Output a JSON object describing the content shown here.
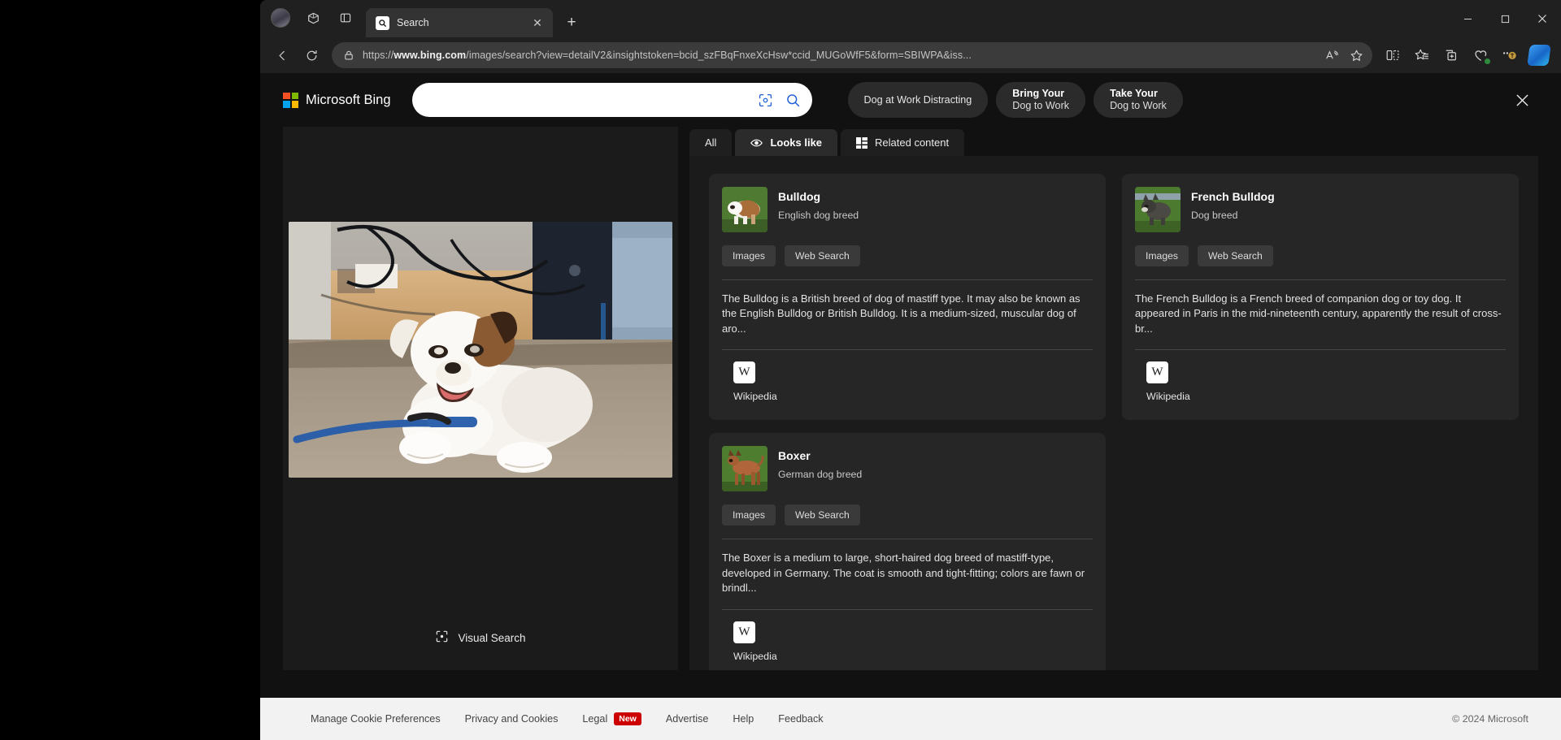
{
  "browser": {
    "tab": {
      "title": "Search",
      "favicon": "bing-search-icon",
      "close_label": "✕"
    },
    "new_tab_label": "+",
    "toolbar_left_icons": [
      "profile-avatar",
      "workspaces-icon",
      "tab-actions-icon"
    ],
    "window_controls": {
      "minimize": "–",
      "maximize": "▢",
      "close": "✕"
    },
    "nav": {
      "back": "←",
      "forward": "→",
      "refresh": "⟳"
    },
    "url": {
      "scheme": "https://",
      "domain": "www.bing.com",
      "path": "/images/search?view=detailV2&insightstoken=bcid_szFBqFnxeXcHsw*ccid_MUGoWfF5&form=SBIWPA&iss..."
    },
    "omnibox_icons": [
      "lock-icon",
      "read-aloud-icon",
      "favorite-star-icon"
    ],
    "toolbar_right_icons": [
      "split-screen-icon",
      "favorites-icon",
      "collections-icon",
      "browser-essentials-icon",
      "extensions-icon",
      "copilot-icon"
    ]
  },
  "bing": {
    "logo_text": "Microsoft Bing",
    "search": {
      "value": "",
      "placeholder": ""
    },
    "search_icons": {
      "camera": "visual-search-camera-icon",
      "submit": "search-magnifier-icon"
    },
    "close_label": "✕",
    "suggestions": [
      {
        "line1": "Dog at Work Distracting",
        "line2": ""
      },
      {
        "line1": "Bring Your",
        "line2": "Dog to Work"
      },
      {
        "line1": "Take Your",
        "line2": "Dog to Work"
      }
    ],
    "visual_search_label": "Visual Search",
    "tabs": [
      {
        "label": "All",
        "icon": "",
        "active": false
      },
      {
        "label": "Looks like",
        "icon": "eye-icon",
        "active": true
      },
      {
        "label": "Related content",
        "icon": "grid-layout-icon",
        "active": false
      }
    ],
    "cards": [
      {
        "title": "Bulldog",
        "subtitle": "English dog breed",
        "actions": [
          "Images",
          "Web Search"
        ],
        "description": "The Bulldog is a British breed of dog of mastiff type. It may also be known as the English Bulldog or British Bulldog. It is a medium-sized, muscular dog of aro...",
        "source": "Wikipedia",
        "source_badge": "W"
      },
      {
        "title": "French Bulldog",
        "subtitle": "Dog breed",
        "actions": [
          "Images",
          "Web Search"
        ],
        "description": "The French Bulldog is a French breed of companion dog or toy dog. It appeared in Paris in the mid-nineteenth century, apparently the result of cross-br...",
        "source": "Wikipedia",
        "source_badge": "W"
      },
      {
        "title": "Boxer",
        "subtitle": "German dog breed",
        "actions": [
          "Images",
          "Web Search"
        ],
        "description": "The Boxer is a medium to large, short-haired dog breed of mastiff-type, developed in Germany. The coat is smooth and tight-fitting; colors are fawn or brindl...",
        "source": "Wikipedia",
        "source_badge": "W"
      }
    ],
    "footer": {
      "links": [
        {
          "label": "Manage Cookie Preferences",
          "badge": ""
        },
        {
          "label": "Privacy and Cookies",
          "badge": ""
        },
        {
          "label": "Legal",
          "badge": "New"
        },
        {
          "label": "Advertise",
          "badge": ""
        },
        {
          "label": "Help",
          "badge": ""
        },
        {
          "label": "Feedback",
          "badge": ""
        }
      ],
      "copyright": "© 2024 Microsoft"
    }
  },
  "colors": {
    "page_bg": "#111111",
    "panel_bg": "#1b1b1b",
    "card_bg": "#262626",
    "accent_red": "#cc0000",
    "search_bg": "#ffffff",
    "footer_bg": "#f2f2f2"
  }
}
